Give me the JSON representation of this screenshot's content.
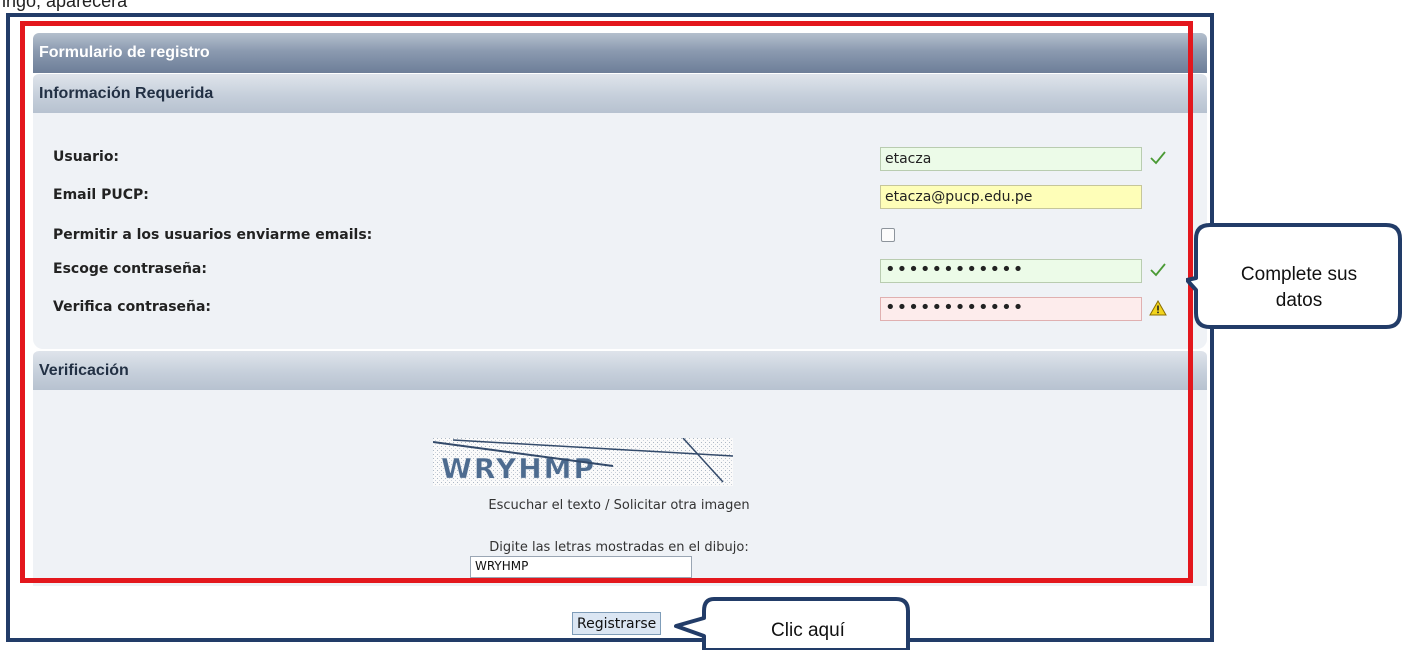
{
  "caption": "ingo, aparecerá",
  "form": {
    "title": "Formulario de registro",
    "required_section": {
      "title": "Información Requerida",
      "fields": [
        {
          "label": "Usuario:",
          "value": "etacza",
          "state": "ok"
        },
        {
          "label": "Email PUCP:",
          "value": "etacza@pucp.edu.pe",
          "state": "highlight"
        },
        {
          "label": "Permitir a los usuarios enviarme emails:",
          "checked": false
        },
        {
          "label": "Escoge contraseña:",
          "value": "••••••••••••",
          "state": "ok"
        },
        {
          "label": "Verifica contraseña:",
          "value": "••••••••••••",
          "state": "warning"
        }
      ]
    },
    "verification_section": {
      "title": "Verificación",
      "captcha_text": "WRYHMP",
      "captcha_links": "Escuchar el texto / Solicitar otra imagen",
      "prompt": "Digite las letras mostradas en el dibujo:",
      "input_value": "WRYHMP"
    },
    "submit_label": "Registrarse"
  },
  "callouts": {
    "fill_data_line1": "Complete sus",
    "fill_data_line2": "datos",
    "click_here": "Clic aquí"
  },
  "colors": {
    "frame": "#223c68",
    "highlight_frame": "#e3171d",
    "ok_field": "#ecfbe8",
    "warn_field": "#fdecec",
    "email_field": "#fefeb8",
    "check_icon": "#4a9a34",
    "warning_icon": "#f2d41c"
  }
}
